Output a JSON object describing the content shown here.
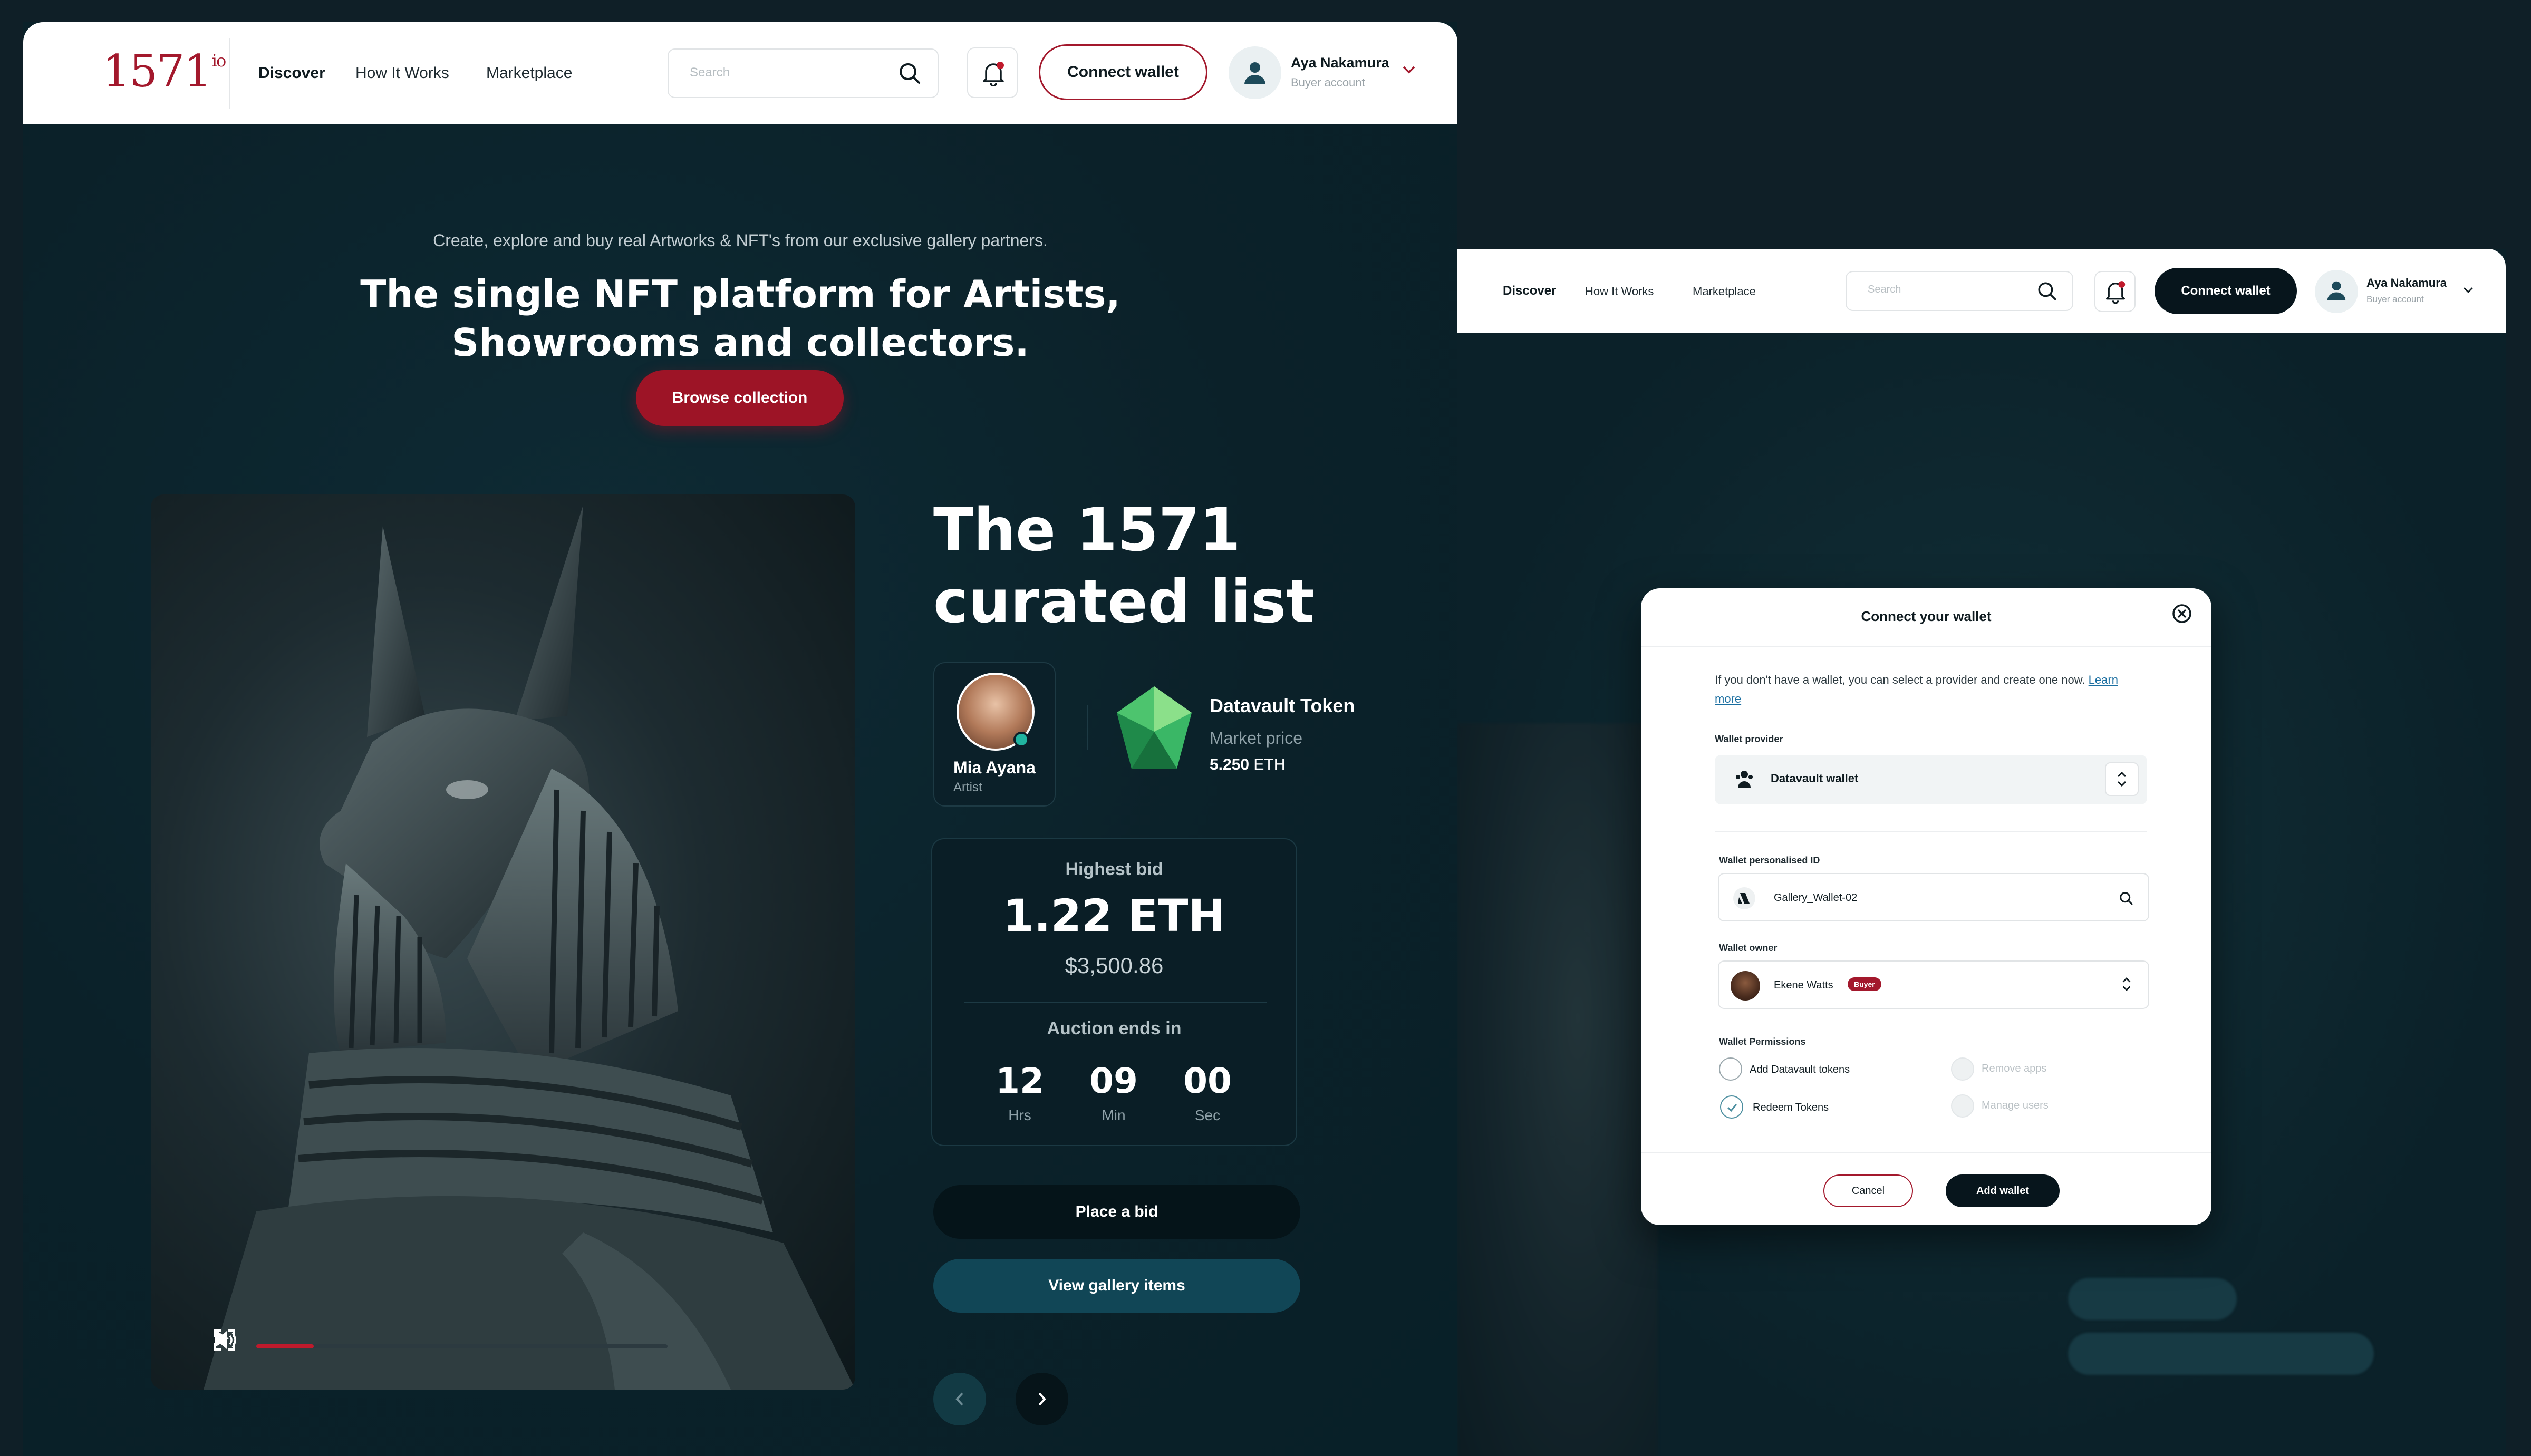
{
  "brand": {
    "logo_text": "1571",
    "logo_suffix": "io",
    "accent": "#a3182c",
    "dark": "#07151c"
  },
  "nav": {
    "items": [
      {
        "label": "Discover",
        "active": true
      },
      {
        "label": "How It Works",
        "active": false
      },
      {
        "label": "Marketplace",
        "active": false
      }
    ]
  },
  "search": {
    "placeholder": "Search"
  },
  "header": {
    "connect_wallet": "Connect wallet"
  },
  "user": {
    "name": "Aya Nakamura",
    "role": "Buyer account"
  },
  "hero": {
    "tagline": "Create, explore and buy real Artworks & NFT's from our exclusive gallery partners.",
    "title_line1": "The single NFT platform for Artists,",
    "title_line2": "Showrooms and collectors.",
    "browse_button": "Browse collection"
  },
  "video": {
    "progress": 0.14
  },
  "curated": {
    "title_line1": "The 1571",
    "title_line2": "curated list",
    "artist": {
      "name": "Mia Ayana",
      "role": "Artist"
    },
    "token": {
      "name": "Datavault Token",
      "label": "Market price",
      "price_value": "5.250",
      "price_unit": "ETH"
    },
    "bid": {
      "label": "Highest bid",
      "value": "1.22 ETH",
      "usd": "$3,500.86",
      "auction_label": "Auction ends in",
      "countdown": [
        {
          "value": "12",
          "unit": "Hrs"
        },
        {
          "value": "09",
          "unit": "Min"
        },
        {
          "value": "00",
          "unit": "Sec"
        }
      ]
    },
    "place_bid": "Place a bid",
    "view_gallery": "View gallery items"
  },
  "modal": {
    "title": "Connect your wallet",
    "intro": "If you don't have a wallet, you can select a provider and create one now.",
    "learn_more": "Learn more",
    "provider_label": "Wallet provider",
    "provider_value": "Datavault wallet",
    "id_label": "Wallet personalised ID",
    "id_value": "Gallery_Wallet-02",
    "owner_label": "Wallet owner",
    "owner_name": "Ekene Watts",
    "owner_badge": "Buyer",
    "permissions_label": "Wallet Permissions",
    "permissions": [
      {
        "label": "Add Datavault tokens",
        "checked": false,
        "disabled": false
      },
      {
        "label": "Remove apps",
        "checked": false,
        "disabled": true
      },
      {
        "label": "Redeem Tokens",
        "checked": true,
        "disabled": false
      },
      {
        "label": "Manage users",
        "checked": false,
        "disabled": true
      }
    ],
    "cancel": "Cancel",
    "add_wallet": "Add wallet"
  }
}
